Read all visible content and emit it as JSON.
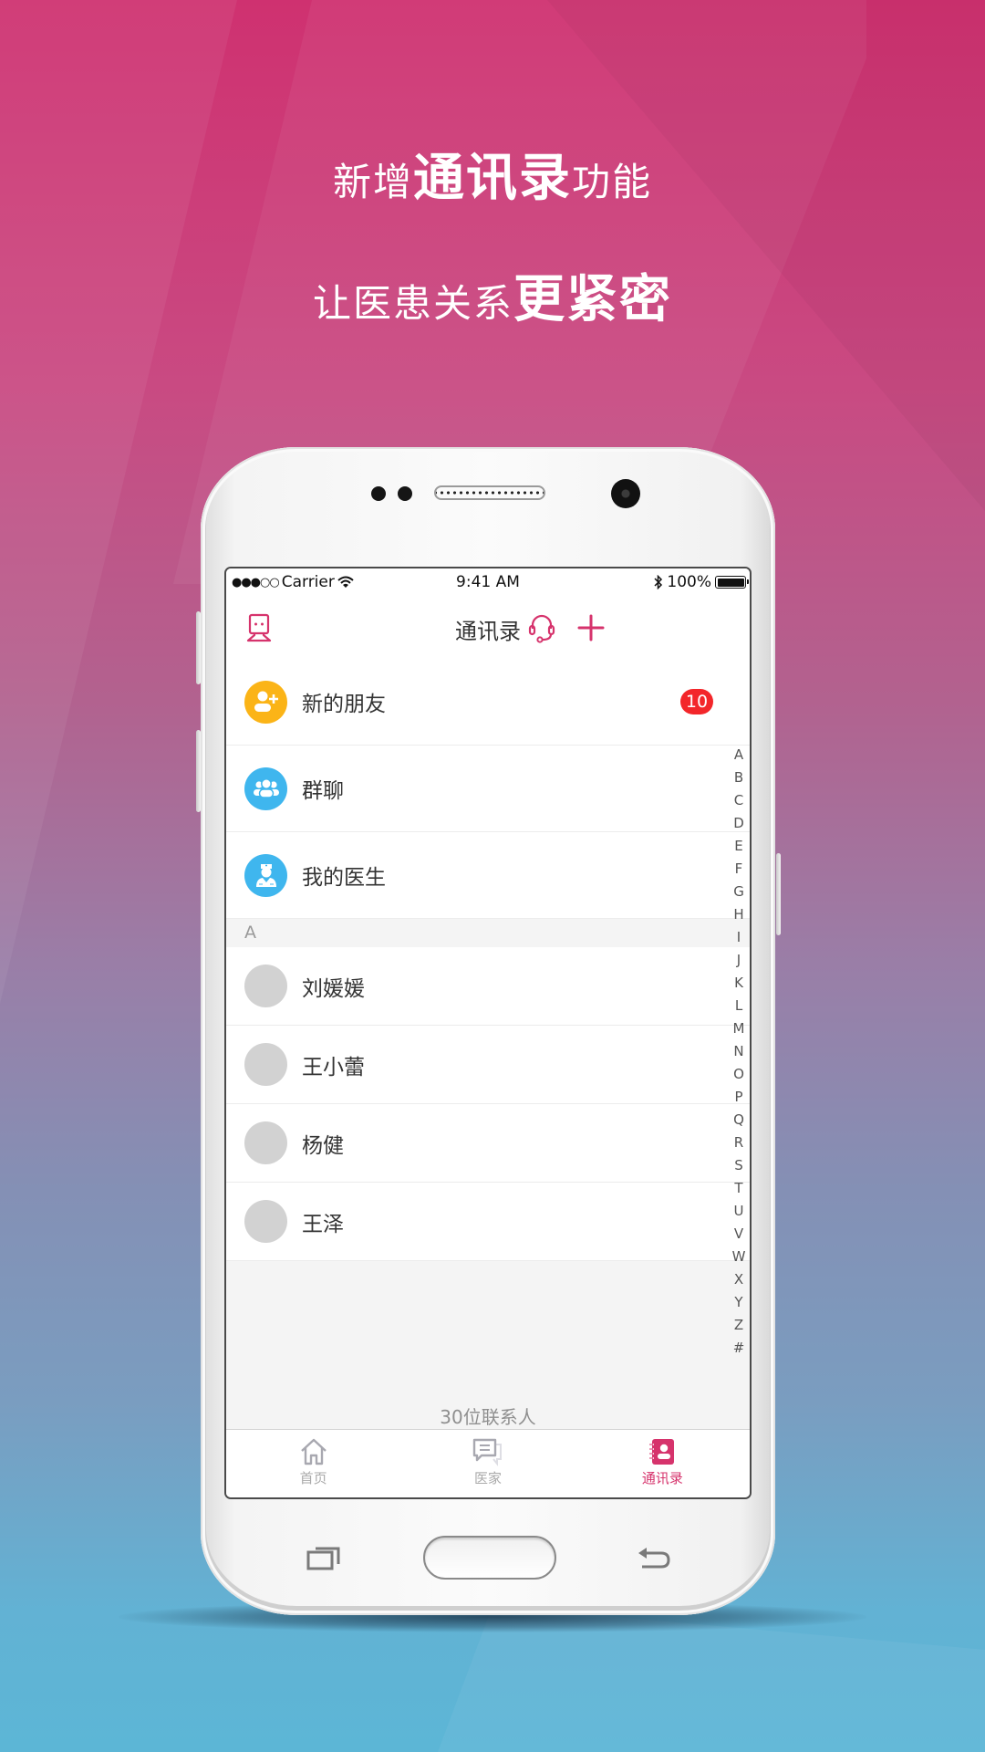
{
  "promo": {
    "line1_prefix": "新增",
    "line1_emphasis": "通讯录",
    "line1_suffix": "功能",
    "line2_prefix": "让医患关系",
    "line2_emphasis": "更紧密"
  },
  "status_bar": {
    "signal": "●●●○○",
    "carrier": "Carrier",
    "time": "9:41 AM",
    "battery_percent": "100%",
    "battery_level": 1.0
  },
  "nav": {
    "title": "通讯录",
    "left_icon": "profile-icon",
    "right_icons": [
      "headset-icon",
      "plus-icon"
    ]
  },
  "shortcuts": [
    {
      "label": "新的朋友",
      "icon": "add-friend-icon",
      "color": "#fbb417",
      "badge": "10"
    },
    {
      "label": "群聊",
      "icon": "group-icon",
      "color": "#3fb6ee"
    },
    {
      "label": "我的医生",
      "icon": "doctor-icon",
      "color": "#3fb6ee"
    }
  ],
  "sections": [
    {
      "header": "A",
      "contacts": [
        "刘媛媛",
        "王小蕾",
        "杨健",
        "王泽"
      ]
    }
  ],
  "index_letters": [
    "A",
    "B",
    "C",
    "D",
    "E",
    "F",
    "G",
    "H",
    "I",
    "J",
    "K",
    "L",
    "M",
    "N",
    "O",
    "P",
    "Q",
    "R",
    "S",
    "T",
    "U",
    "V",
    "W",
    "X",
    "Y",
    "Z",
    "#"
  ],
  "contact_count": "30位联系人",
  "tabs": [
    {
      "label": "首页",
      "icon": "home-icon",
      "active": false
    },
    {
      "label": "医家",
      "icon": "chat-icon",
      "active": false
    },
    {
      "label": "通讯录",
      "icon": "contacts-icon",
      "active": true
    }
  ],
  "colors": {
    "accent": "#d6336c",
    "badge": "#f3262a",
    "avatar_placeholder": "#d2d2d2"
  }
}
